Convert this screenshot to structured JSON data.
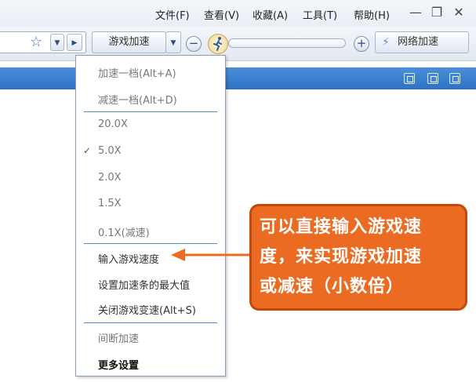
{
  "menubar": {
    "items": [
      "文件(F)",
      "查看(V)",
      "收藏(A)",
      "工具(T)",
      "帮助(H)"
    ],
    "minimize": "—",
    "restore": "❐",
    "close": "✕"
  },
  "toolbar": {
    "speed_button": "游戏加速",
    "network_button": "网络加速",
    "minus": "−",
    "plus": "+"
  },
  "dropdown": {
    "items": [
      "加速一档(Alt+A)",
      "减速一档(Alt+D)",
      "20.0X",
      "5.0X",
      "2.0X",
      "1.5X",
      "0.1X(减速)",
      "输入游戏速度",
      "设置加速条的最大值",
      "关闭游戏变速(Alt+S)",
      "间断加速",
      "更多设置"
    ],
    "checked": "✓"
  },
  "callout": {
    "lines": [
      "可以直接输入游戏速",
      "度，来实现游戏加速",
      "或减速（小数倍）"
    ]
  },
  "colors": {
    "accent_orange": "#ec6b22",
    "strip_blue": "#2e72c4"
  }
}
